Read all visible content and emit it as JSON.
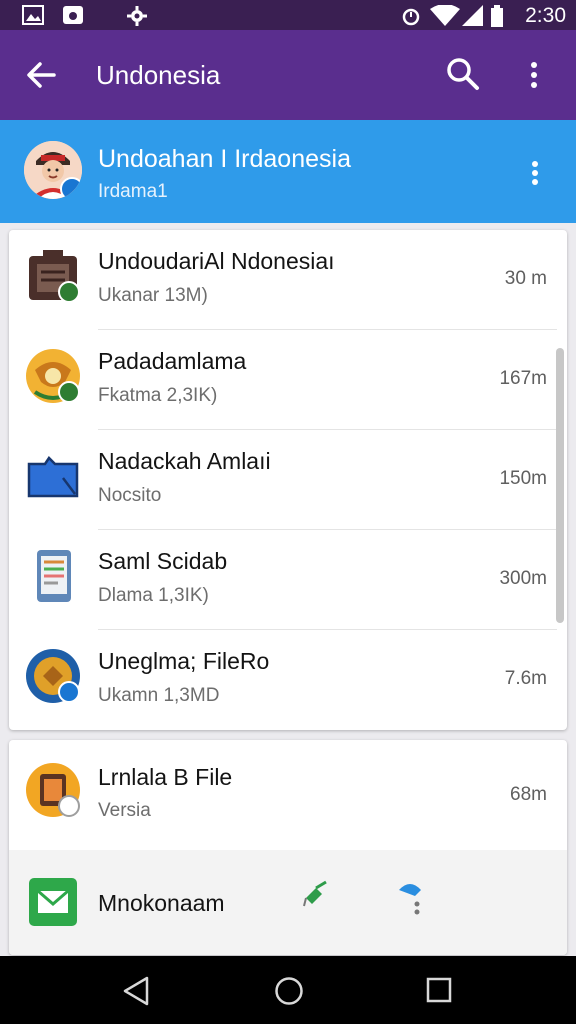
{
  "status_bar": {
    "time": "2:30"
  },
  "app_bar": {
    "title": "Undonesia"
  },
  "account": {
    "name": "Undoahan I Irdaonesia",
    "subtitle": "Irdama1"
  },
  "files": [
    {
      "name": "UndoudariAl Ndonesiaı",
      "subtitle": "Ukanar 13M)",
      "meta": "30 m"
    },
    {
      "name": "Padadamlama",
      "subtitle": "Fkatma 2,3IK)",
      "meta": "167m"
    },
    {
      "name": "Nadackah Amlaıi",
      "subtitle": "Nocsito",
      "meta": "150m"
    },
    {
      "name": "Saml Scidab",
      "subtitle": "Dlama 1,3IK)",
      "meta": "300m"
    },
    {
      "name": "Uneglma; FileRo",
      "subtitle": "Ukamn 1,3MD",
      "meta": "7.6m"
    }
  ],
  "card2_row": {
    "name": "Lrnlala B File",
    "subtitle": "Versia",
    "meta": "68m"
  },
  "action_row": {
    "label": "Mnokonaam"
  },
  "colors": {
    "status_bar": "#3a1f52",
    "app_bar": "#5a2e8e",
    "account_header": "#2f9bea"
  }
}
